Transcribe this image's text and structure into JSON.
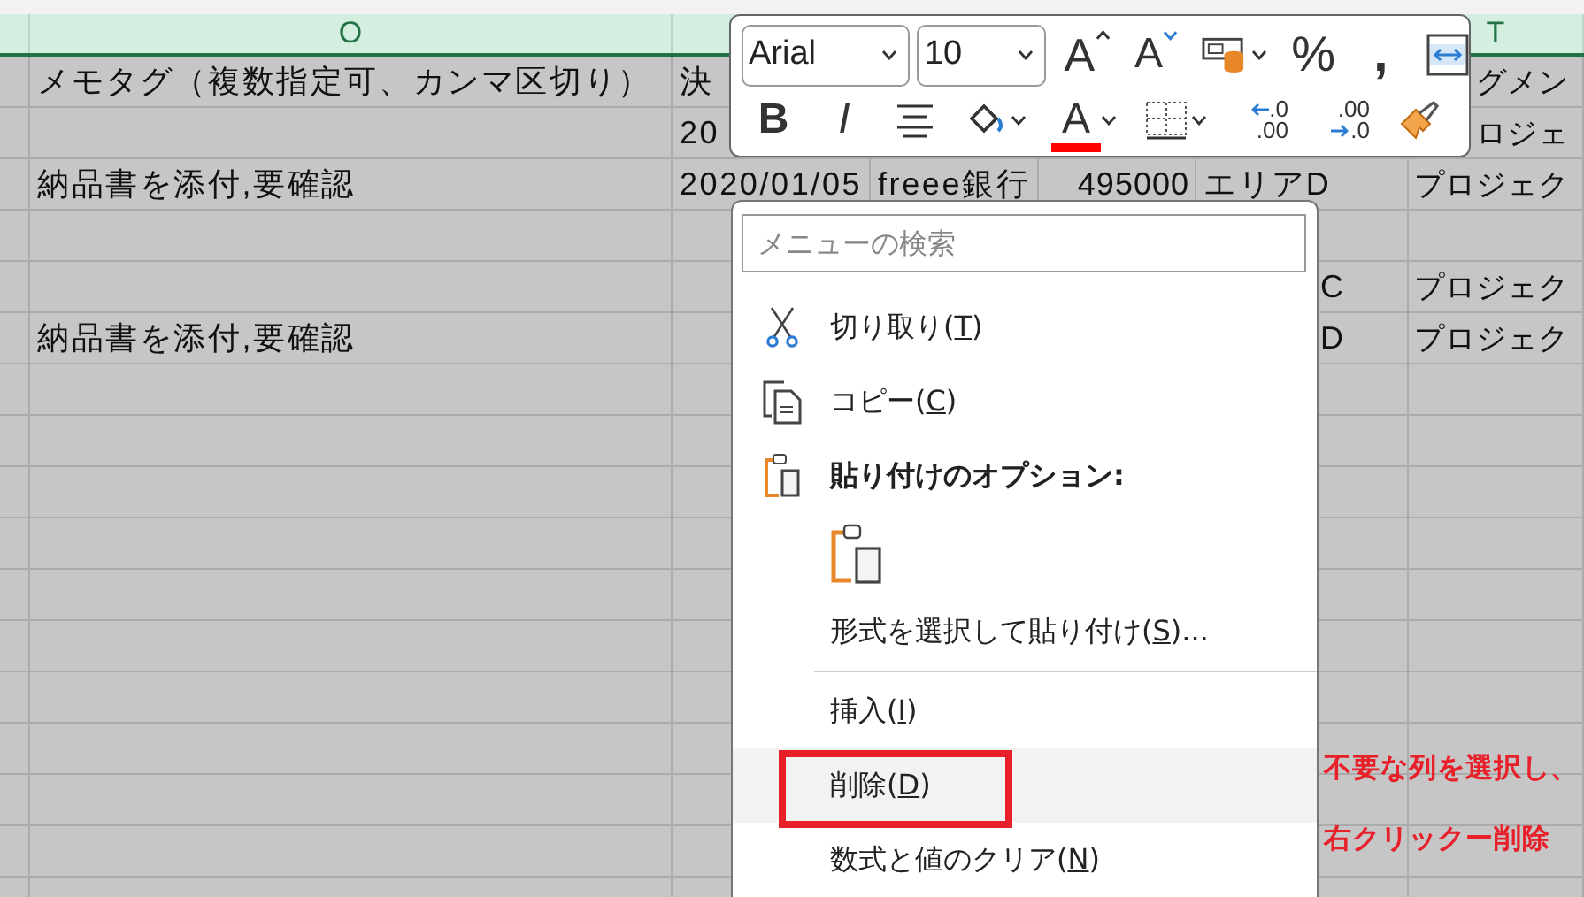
{
  "sheet": {
    "column_headers": {
      "column_o": "O",
      "column_t": "T"
    },
    "rows": [
      {
        "column_o": "メモタグ（複数指定可、カンマ区切り）",
        "column_p": "決",
        "column_t": "グメン"
      },
      {
        "column_p": "20",
        "column_t": "ロジェ"
      },
      {
        "column_o": "納品書を添付,要確認",
        "column_p": "2020/01/05",
        "column_q": "freee銀行",
        "column_r": "495000",
        "column_s": "エリアD",
        "column_t": "プロジェク"
      },
      {},
      {
        "column_s": "C",
        "column_t": "プロジェク"
      },
      {
        "column_o": "納品書を添付,要確認",
        "column_s": "D",
        "column_t": "プロジェク"
      }
    ]
  },
  "mini_toolbar": {
    "font": "Arial",
    "size": "10",
    "grow_font": "A",
    "shrink_font": "A",
    "percent": "%",
    "comma": ",",
    "bold": "B",
    "italic": "I",
    "font_color": {
      "text": "A",
      "color": "#ff0000"
    },
    "increase_decimal": {
      "top": ".0",
      "bottom": ".00"
    },
    "decrease_decimal": {
      "top": ".00",
      "bottom": ".0"
    }
  },
  "context_menu": {
    "search": {
      "placeholder": "メニューの検索"
    },
    "items": [
      {
        "kind": "command",
        "label": "切り取り(",
        "key": "T",
        "tail": ")",
        "highlighted": false,
        "framed": false
      },
      {
        "kind": "command",
        "label": "コピー(",
        "key": "C",
        "tail": ")",
        "highlighted": false,
        "framed": false
      },
      {
        "kind": "heading",
        "label": "貼り付けのオプション:"
      },
      {
        "kind": "paste-option"
      },
      {
        "kind": "command",
        "label": "形式を選択して貼り付け(",
        "key": "S",
        "tail": ")...",
        "highlighted": false,
        "framed": false
      },
      {
        "kind": "separator"
      },
      {
        "kind": "command",
        "label": "挿入(",
        "key": "I",
        "tail": ")",
        "highlighted": false,
        "framed": false
      },
      {
        "kind": "command",
        "label": "削除(",
        "key": "D",
        "tail": ")",
        "highlighted": true,
        "framed": true
      },
      {
        "kind": "command",
        "label": "数式と値のクリア(",
        "key": "N",
        "tail": ")",
        "highlighted": false,
        "framed": false
      }
    ]
  },
  "annotation": {
    "lines": [
      "不要な列を選択し、",
      "右クリックー削除"
    ]
  }
}
